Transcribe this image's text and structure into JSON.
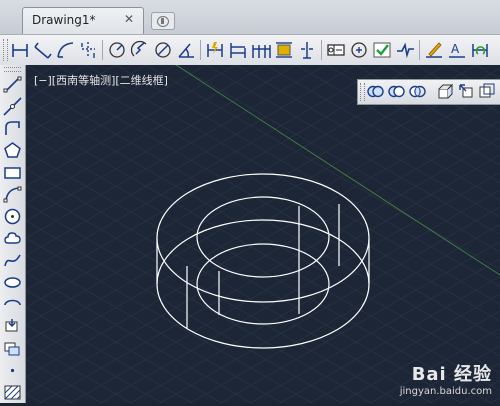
{
  "tab": {
    "title": "Drawing1*",
    "close_symbol": "✕"
  },
  "viewport": {
    "label": "[−][西南等轴测][二维线框]"
  },
  "watermark": {
    "logo": "Bai 经验",
    "url": "jingyan.baidu.com"
  },
  "colors": {
    "canvas_bg": "#1d2637",
    "grid": "#2c3648",
    "ucs_line": "#3f7a3f",
    "geometry": "#ffffff"
  },
  "toolbar": {
    "icons": [
      "linear-dimension-icon",
      "aligned-dimension-icon",
      "arc-length-icon",
      "ordinate-dimension-icon",
      "radius-dimension-icon",
      "jogged-dimension-icon",
      "diameter-dimension-icon",
      "angular-dimension-icon",
      "quick-dimension-icon",
      "baseline-dimension-icon",
      "continue-dimension-icon",
      "dimension-space-icon",
      "dimension-break-icon",
      "tolerance-icon",
      "center-mark-icon",
      "inspection-icon",
      "jogged-linear-icon",
      "dimension-edit-icon",
      "dimension-text-edit-icon",
      "dimension-update-icon"
    ]
  },
  "left_toolbar": {
    "icons": [
      "line-icon",
      "construction-line-icon",
      "polyline-icon",
      "polygon-icon",
      "rectangle-icon",
      "arc-icon",
      "circle-icon",
      "revision-cloud-icon",
      "spline-icon",
      "ellipse-icon",
      "ellipse-arc-icon",
      "insert-block-icon",
      "make-block-icon",
      "point-icon",
      "hatch-icon"
    ]
  },
  "float_toolbar": {
    "icons": [
      "union-icon",
      "subtract-icon",
      "intersect-icon",
      "extrude-faces-icon",
      "move-faces-icon",
      "offset-faces-icon"
    ]
  }
}
